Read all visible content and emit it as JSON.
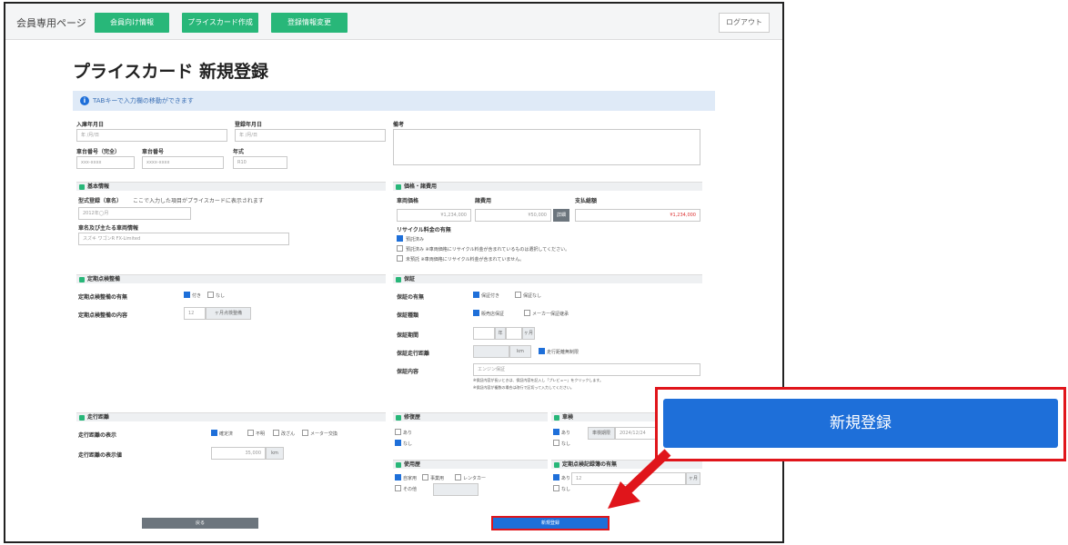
{
  "topbar": {
    "member_title": "会員専用ページ",
    "nav": [
      "会員向け情報",
      "プライスカード作成",
      "登録情報変更"
    ],
    "logout": "ログアウト"
  },
  "page_title": "プライスカード 新規登録",
  "info_message": "TABキーで入力欄の移動ができます",
  "form": {
    "register_date": {
      "label": "入庫年月日",
      "value": "年 /月/日"
    },
    "registration_date": {
      "label": "登録年月日",
      "value": "年 /月/日"
    },
    "remarks": {
      "label": "備考"
    },
    "vehicle_number": {
      "label": "車台番号（完全）",
      "placeholder": "xxx-xxxx"
    },
    "vehicle_number2": {
      "label": "車台番号",
      "placeholder": "xxxx-xxxx"
    },
    "year": {
      "label": "年式",
      "placeholder": "R10"
    },
    "sec_basic": "基本情報",
    "car_name": {
      "label": "型式登録（車名）",
      "hint": "ここで入力した項目がプライスカードに表示されます",
      "placeholder": "2012年◯月"
    },
    "maker_model": {
      "label": "車名及び主たる車両情報",
      "placeholder": "スズキ ワゴンR FX-Limited"
    },
    "sec_price": "価格・諸費用",
    "vehicle_price": {
      "label": "車両価格",
      "value": "¥1,234,000"
    },
    "expenses": {
      "label": "諸費用",
      "value": "¥50,000",
      "btn": "詳細"
    },
    "total_price": {
      "label": "支払総額",
      "value": "¥1,234,000"
    },
    "recycle": {
      "label": "リサイクル料金の有無",
      "options": [
        "預託済み",
        "預託済み ※車両価格にリサイクル料金が含まれているものは選択してください。",
        "未預託 ※車両価格にリサイクル料金が含まれていません。"
      ]
    },
    "sec_inspection": "定期点検整備",
    "inspection_presence": {
      "label": "定期点検整備の有無",
      "options": [
        "付き",
        "なし"
      ]
    },
    "inspection_content": {
      "label": "定期点検整備の内容",
      "value": "12",
      "unit": "ヶ月点検整備"
    },
    "sec_warranty": "保証",
    "warranty_presence": {
      "label": "保証の有無",
      "options": [
        "保証付き",
        "保証なし"
      ]
    },
    "warranty_type": {
      "label": "保証種類",
      "options": [
        "販売店保証",
        "メーカー保証継承"
      ]
    },
    "warranty_period": {
      "label": "保証期間",
      "year_unit": "年",
      "month_unit": "ヶ月"
    },
    "warranty_distance": {
      "label": "保証走行距離",
      "unit": "km",
      "option": "走行距離無制限"
    },
    "warranty_detail": {
      "label": "保証内容",
      "placeholder": "エンジン保証"
    },
    "warranty_notes": [
      "※保証内容が長いときは、保証内容を記入し「プレビュー」をクリックします。",
      "※保証内容が複数の場合は改行で区切って入力してください。"
    ],
    "sec_mileage": "走行距離",
    "mileage_presence": {
      "label": "走行距離の表示",
      "options": [
        "確定済",
        "不明",
        "改ざん",
        "メーター交換"
      ]
    },
    "mileage_value": {
      "label": "走行距離の表示値",
      "value": "35,000",
      "unit": "km"
    },
    "sec_repair": "修復歴",
    "repair_options": [
      "あり",
      "なし"
    ],
    "sec_vehicle_inspection": "車検",
    "vehicle_inspection_options": [
      "あり",
      "なし"
    ],
    "vehicle_inspection_value": {
      "btn": "車検期限",
      "value": "2024/12/24"
    },
    "sec_usage": "使用歴",
    "usage_options": [
      "自家用",
      "事業用",
      "レンタカー",
      "その他"
    ],
    "sec_maintenance": "定期点検記録簿の有無",
    "maintenance_options": [
      "あり",
      "なし"
    ],
    "maintenance_value": {
      "value": "12",
      "unit": "ヶ月"
    }
  },
  "buttons": {
    "back": "戻る",
    "submit": "新規登録"
  },
  "callout_button": "新規登録",
  "colors": {
    "green": "#28b779",
    "blue": "#1e6fd9",
    "red": "#e0151b"
  }
}
